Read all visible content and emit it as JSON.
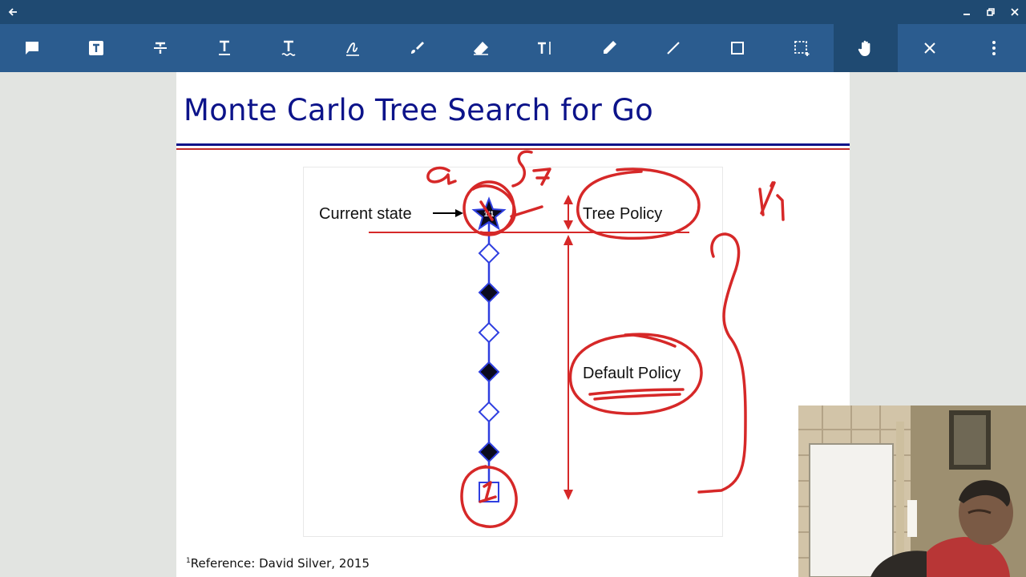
{
  "titlebar": {
    "back_icon": "back-arrow-icon",
    "minimize_icon": "minimize-icon",
    "restore_icon": "restore-icon",
    "close_icon": "close-icon"
  },
  "toolbar": {
    "tools": [
      {
        "name": "comment-tool",
        "icon": "comment-icon"
      },
      {
        "name": "text-box-tool",
        "icon": "text-box-icon"
      },
      {
        "name": "strikethrough-tool",
        "icon": "strikethrough-icon"
      },
      {
        "name": "underline-tool",
        "icon": "underline-icon"
      },
      {
        "name": "squiggly-tool",
        "icon": "squiggly-underline-icon"
      },
      {
        "name": "signature-tool",
        "icon": "signature-icon"
      },
      {
        "name": "brush-tool",
        "icon": "brush-icon"
      },
      {
        "name": "eraser-tool",
        "icon": "eraser-icon"
      },
      {
        "name": "free-text-tool",
        "icon": "free-text-icon"
      },
      {
        "name": "pencil-tool",
        "icon": "pencil-icon"
      },
      {
        "name": "line-tool",
        "icon": "line-icon"
      },
      {
        "name": "rectangle-tool",
        "icon": "rectangle-icon"
      },
      {
        "name": "area-select-tool",
        "icon": "area-select-icon"
      },
      {
        "name": "pan-tool",
        "icon": "hand-icon",
        "active": true
      },
      {
        "name": "close-toolbar",
        "icon": "close-icon"
      },
      {
        "name": "more-options",
        "icon": "more-vert-icon"
      }
    ],
    "bg_color": "#2b5c8f",
    "active_color": "#1f4a72"
  },
  "slide": {
    "title": "Monte Carlo Tree Search for Go",
    "title_color": "#0c138a",
    "diagram": {
      "current_state_label": "Current state",
      "node_visit_label": "1/1",
      "tree_policy_label": "Tree Policy",
      "default_policy_label": "Default Policy"
    },
    "footnote_number": "1",
    "footnote": "Reference: David Silver, 2015"
  },
  "annotations": {
    "ink_color": "#d62828",
    "handwritten": [
      "a",
      "S",
      "1/1",
      "1"
    ]
  }
}
